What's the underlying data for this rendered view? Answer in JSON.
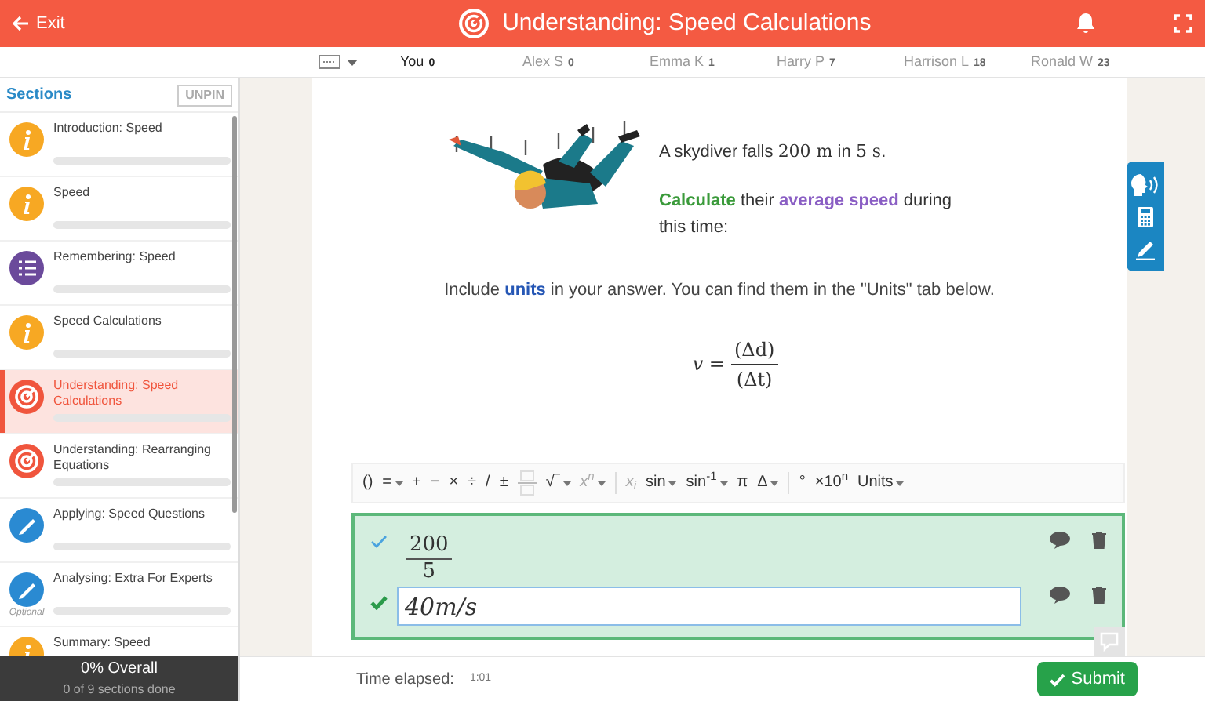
{
  "header": {
    "exit": "Exit",
    "title": "Understanding: Speed Calculations"
  },
  "leaderboard": [
    {
      "name": "You",
      "score": "0",
      "selected": true
    },
    {
      "name": "Alex S",
      "score": "0",
      "selected": false
    },
    {
      "name": "Emma K",
      "score": "1",
      "selected": false
    },
    {
      "name": "Harry P",
      "score": "7",
      "selected": false
    },
    {
      "name": "Harrison L",
      "score": "18",
      "selected": false
    },
    {
      "name": "Ronald W",
      "score": "23",
      "selected": false
    }
  ],
  "sidebar": {
    "title": "Sections",
    "unpin": "UNPIN",
    "items": [
      {
        "title": "Introduction: Speed",
        "kind": "info",
        "selected": false,
        "level": 0
      },
      {
        "title": "Speed",
        "kind": "info",
        "selected": false,
        "level": 0
      },
      {
        "title": "Remembering: Speed",
        "kind": "list",
        "selected": false,
        "level": 0
      },
      {
        "title": "Speed Calculations",
        "kind": "info",
        "selected": false,
        "level": 0
      },
      {
        "title": "Understanding: Speed Calculations",
        "kind": "target",
        "selected": true,
        "level": 0
      },
      {
        "title": "Understanding: Rearranging Equations",
        "kind": "target",
        "selected": false,
        "level": 0
      },
      {
        "title": "Applying: Speed Questions",
        "kind": "pencil",
        "selected": false,
        "level": 0
      },
      {
        "title": "Analysing: Extra For Experts",
        "kind": "pencil",
        "selected": false,
        "badge": "Optional",
        "level": 0
      },
      {
        "title": "Summary: Speed",
        "kind": "info",
        "selected": false
      }
    ],
    "overall": "0% Overall",
    "overall_sub": "0 of 9 sections done"
  },
  "question": {
    "lines": [
      [
        {
          "kind": "plain",
          "text": "A skydiver falls "
        },
        {
          "kind": "math",
          "text": "200 m"
        },
        {
          "kind": "plain",
          "text": " in "
        },
        {
          "kind": "math",
          "text": "5 s"
        },
        {
          "kind": "plain",
          "text": "."
        }
      ],
      [
        {
          "kind": "verb",
          "text": "Calculate"
        },
        {
          "kind": "plain",
          "text": " their "
        },
        {
          "kind": "term",
          "text": "average speed"
        },
        {
          "kind": "plain",
          "text": " during this time:"
        }
      ]
    ],
    "note": [
      {
        "kind": "plain",
        "text": "Include "
      },
      {
        "kind": "unit",
        "text": "units"
      },
      {
        "kind": "plain",
        "text": " in your answer. You can find them in the \"Units\" tab below."
      }
    ],
    "formula": {
      "lhs": "v =",
      "numerator": "(Δd)",
      "denominator": "(Δt)"
    }
  },
  "toolbar": [
    {
      "kind": "key",
      "label": "()",
      "caret": false,
      "muted": false
    },
    {
      "kind": "key",
      "label": "=",
      "caret": true,
      "muted": false
    },
    {
      "kind": "key",
      "label": "+",
      "caret": false,
      "muted": false
    },
    {
      "kind": "key",
      "label": "−",
      "caret": false,
      "muted": false
    },
    {
      "kind": "key",
      "label": "×",
      "caret": false,
      "muted": false
    },
    {
      "kind": "key",
      "label": "÷",
      "caret": false,
      "muted": false
    },
    {
      "kind": "key",
      "label": "/",
      "caret": false,
      "muted": false
    },
    {
      "kind": "key",
      "label": "±",
      "caret": false,
      "muted": false
    },
    {
      "kind": "fraction"
    },
    {
      "kind": "key",
      "label": "√‾",
      "caret": true,
      "muted": false
    },
    {
      "kind": "key",
      "label": "x$^{n}$",
      "caret": true,
      "muted": true
    },
    {
      "kind": "separator"
    },
    {
      "kind": "key",
      "label": "x$_{i}$",
      "caret": false,
      "muted": true
    },
    {
      "kind": "key",
      "label": "sin",
      "caret": true,
      "muted": false
    },
    {
      "kind": "key",
      "label": "sin$^{-1}$",
      "caret": true,
      "muted": false
    },
    {
      "kind": "key",
      "label": "π",
      "caret": false,
      "muted": false
    },
    {
      "kind": "key",
      "label": "Δ",
      "caret": true,
      "muted": false
    },
    {
      "kind": "separator"
    },
    {
      "kind": "key",
      "label": "°",
      "caret": false,
      "muted": false
    },
    {
      "kind": "key",
      "label": "×10$^{n}$",
      "caret": false,
      "muted": false
    },
    {
      "kind": "key",
      "label": "Units",
      "caret": true,
      "muted": false
    }
  ],
  "answers": [
    {
      "kind": "fraction",
      "verified": false,
      "numerator": "200",
      "denominator": "5"
    },
    {
      "kind": "input",
      "verified": true,
      "value": "40m/s"
    }
  ],
  "footer": {
    "label": "Time elapsed:",
    "time": "1:01",
    "submit": "Submit"
  }
}
